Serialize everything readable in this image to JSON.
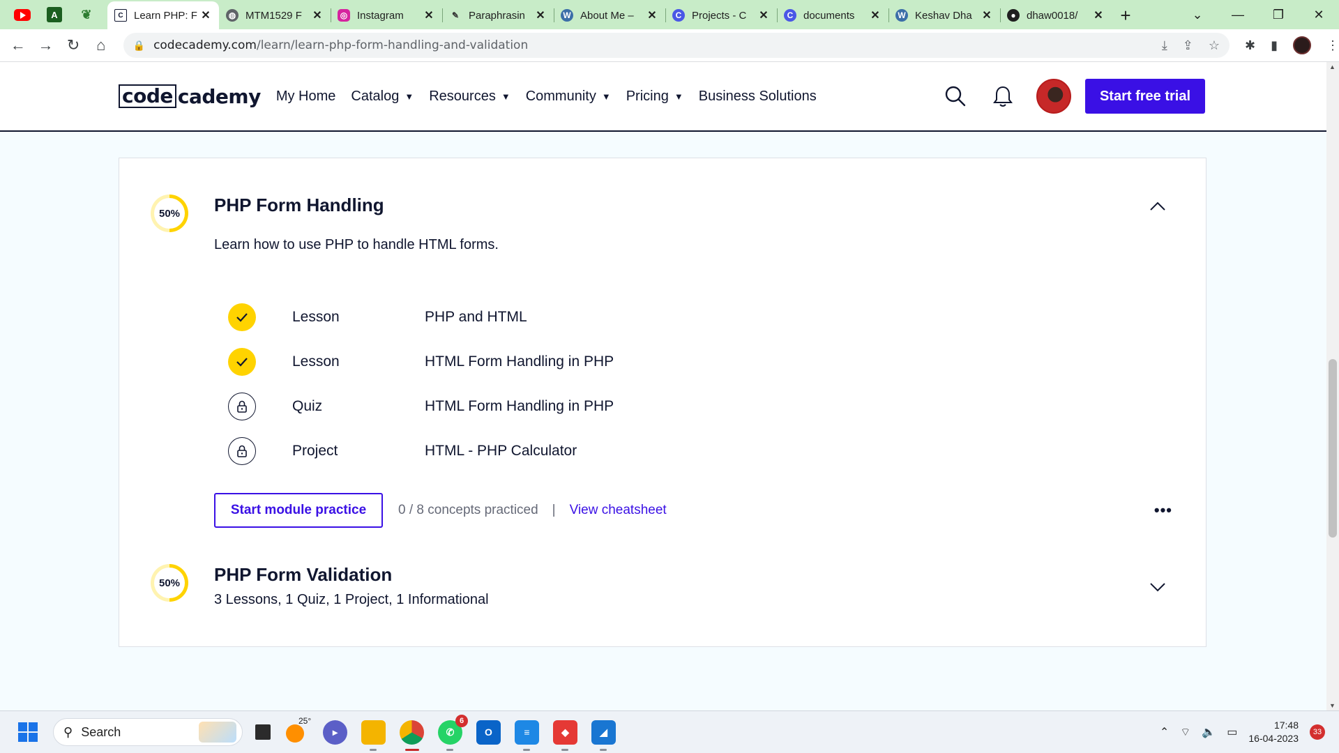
{
  "browser": {
    "tabs": [
      {
        "title": "Learn PHP: F",
        "icon": "codecademy-icon",
        "active": true
      },
      {
        "title": "MTM1529 F",
        "icon": "globe-icon",
        "active": false
      },
      {
        "title": "Instagram",
        "icon": "instagram-icon",
        "active": false
      },
      {
        "title": "Paraphrasin",
        "icon": "quill-icon",
        "active": false
      },
      {
        "title": "About Me –",
        "icon": "wordpress-icon",
        "active": false
      },
      {
        "title": "Projects - C",
        "icon": "codecademy-c-icon",
        "active": false
      },
      {
        "title": "documents",
        "icon": "codecademy-c-icon",
        "active": false
      },
      {
        "title": "Keshav Dha",
        "icon": "wordpress-icon",
        "active": false
      },
      {
        "title": "dhaw0018/",
        "icon": "github-icon",
        "active": false
      }
    ],
    "url_domain": "codecademy.com",
    "url_path": "/learn/learn-php-form-handling-and-validation"
  },
  "site": {
    "logo_box": "code",
    "logo_rest": "cademy",
    "nav": [
      {
        "label": "My Home",
        "dropdown": false
      },
      {
        "label": "Catalog",
        "dropdown": true
      },
      {
        "label": "Resources",
        "dropdown": true
      },
      {
        "label": "Community",
        "dropdown": true
      },
      {
        "label": "Pricing",
        "dropdown": true
      },
      {
        "label": "Business Solutions",
        "dropdown": false
      }
    ],
    "cta": "Start free trial"
  },
  "modules": [
    {
      "progress": "50%",
      "progress_value": 0.5,
      "title": "PHP Form Handling",
      "description": "Learn how to use PHP to handle HTML forms.",
      "expanded": true,
      "items": [
        {
          "type": "Lesson",
          "name": "PHP and HTML",
          "status": "done"
        },
        {
          "type": "Lesson",
          "name": "HTML Form Handling in PHP",
          "status": "done"
        },
        {
          "type": "Quiz",
          "name": "HTML Form Handling in PHP",
          "status": "locked"
        },
        {
          "type": "Project",
          "name": "HTML - PHP Calculator",
          "status": "locked"
        }
      ],
      "practice_button": "Start module practice",
      "concepts": "0 / 8 concepts practiced",
      "separator": "|",
      "cheatsheet": "View cheatsheet",
      "more": "•••"
    },
    {
      "progress": "50%",
      "progress_value": 0.5,
      "title": "PHP Form Validation",
      "description": "3 Lessons, 1 Quiz, 1 Project, 1 Informational",
      "expanded": false
    }
  ],
  "taskbar": {
    "search_placeholder": "Search",
    "weather_temp": "25°",
    "whatsapp_badge": "6",
    "time": "17:48",
    "date": "16-04-2023",
    "notifications": "33"
  },
  "colors": {
    "accent": "#3a10e5",
    "progress": "#ffd300",
    "navy": "#10162f",
    "tabstrip": "#c8ecc8"
  }
}
